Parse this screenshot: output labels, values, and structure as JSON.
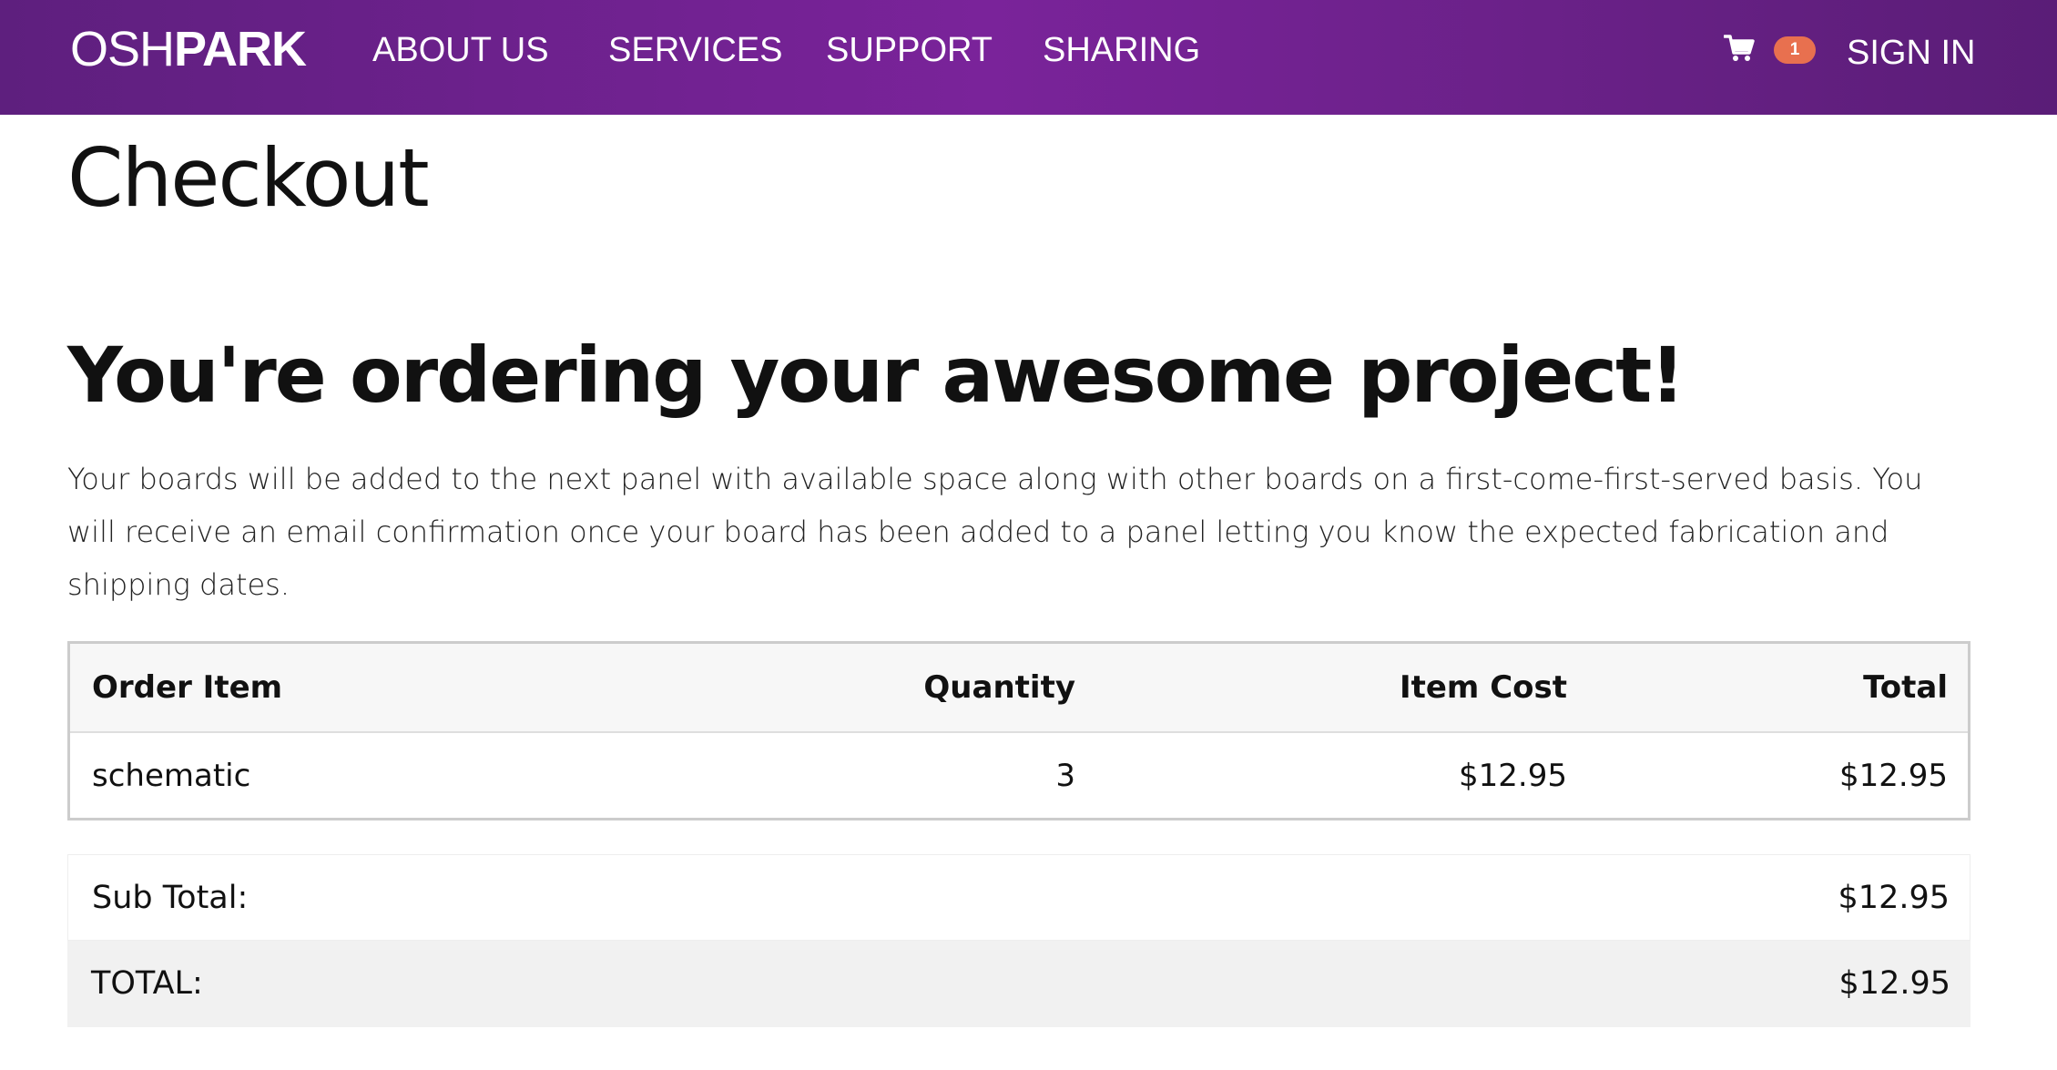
{
  "brand": {
    "logo_light": "OSH",
    "logo_bold": "PARK"
  },
  "nav": {
    "items": [
      {
        "label": "ABOUT US"
      },
      {
        "label": "SERVICES"
      },
      {
        "label": "SUPPORT"
      },
      {
        "label": "SHARING"
      }
    ],
    "cart_icon": "shopping-cart-icon",
    "cart_count": "1",
    "sign_in": "SIGN IN"
  },
  "colors": {
    "header_gradient": [
      "#5e1f7e",
      "#7a239a",
      "#5a1d77"
    ],
    "cart_badge": "#e8704f"
  },
  "page": {
    "title": "Checkout",
    "headline": "You're ordering your awesome project!",
    "intro": "Your boards will be added to the next panel with available space along with other boards on a first-come-first-served basis. You will receive an email confirmation once your board has been added to a panel letting you know the expected fabrication and shipping dates."
  },
  "order_table": {
    "headers": {
      "item": "Order Item",
      "quantity": "Quantity",
      "item_cost": "Item Cost",
      "total": "Total"
    },
    "rows": [
      {
        "item": "schematic",
        "quantity": "3",
        "item_cost": "$12.95",
        "total": "$12.95"
      }
    ]
  },
  "totals": {
    "subtotal_label": "Sub Total:",
    "subtotal_value": "$12.95",
    "total_label": "TOTAL:",
    "total_value": "$12.95"
  }
}
